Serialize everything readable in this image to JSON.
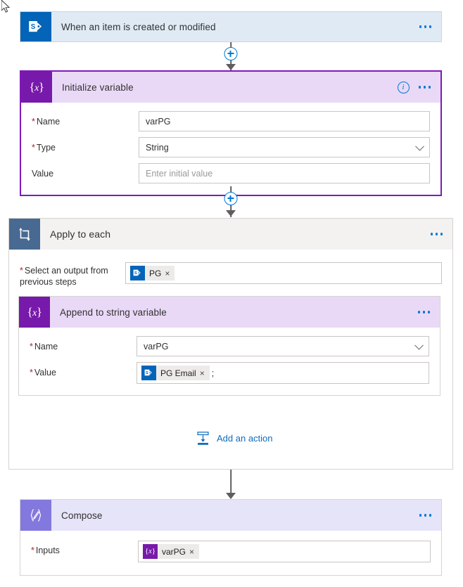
{
  "colors": {
    "accent_blue": "#0078d4",
    "link_blue": "#0f6cbd",
    "variable_purple": "#7719aa",
    "variable_header_bg": "#e9d9f7",
    "compose_purple": "#8378de",
    "compose_header_bg": "#e6e4f8",
    "loop_icon_bg": "#486991",
    "loop_header_bg": "#f3f2f1",
    "trigger_header_bg": "#dfeaf4",
    "sharepoint_blue": "#0364b8",
    "required_red": "#a4262c",
    "border_grey": "#c8c6c4"
  },
  "trigger": {
    "title": "When an item is created or modified",
    "icon": "sharepoint-icon",
    "overflow_label": "More commands"
  },
  "initialize_variable": {
    "title": "Initialize variable",
    "icon": "variable-braces-icon",
    "info_label": "i",
    "overflow_label": "More commands",
    "fields": [
      {
        "label": "Name",
        "required": true,
        "value": "varPG",
        "placeholder": "",
        "type": "text"
      },
      {
        "label": "Type",
        "required": true,
        "value": "String",
        "placeholder": "",
        "type": "dropdown"
      },
      {
        "label": "Value",
        "required": false,
        "value": "",
        "placeholder": "Enter initial value",
        "type": "text"
      }
    ]
  },
  "apply_to_each": {
    "title": "Apply to each",
    "icon": "loop-icon",
    "overflow_label": "More commands",
    "output_field": {
      "label": "Select an output from previous steps",
      "required": true,
      "token": {
        "icon": "sharepoint-icon",
        "label": "PG",
        "remove": "×"
      }
    },
    "add_action": {
      "label": "Add an action",
      "icon": "add-action-icon"
    }
  },
  "append_to_string": {
    "title": "Append to string variable",
    "icon": "variable-braces-icon",
    "overflow_label": "More commands",
    "name_field": {
      "label": "Name",
      "required": true,
      "value": "varPG",
      "type": "dropdown"
    },
    "value_field": {
      "label": "Value",
      "required": true,
      "token": {
        "icon": "sharepoint-icon",
        "label": "PG Email",
        "remove": "×"
      },
      "trailing_text": ";"
    }
  },
  "compose": {
    "title": "Compose",
    "icon": "compose-pen-icon",
    "overflow_label": "More commands",
    "inputs_field": {
      "label": "Inputs",
      "required": true,
      "token": {
        "icon": "variable-braces-icon",
        "label": "varPG",
        "remove": "×"
      }
    }
  },
  "connectors": [
    {
      "name": "trigger-to-initialize",
      "has_plus": true,
      "plus_label": "Insert a new step"
    },
    {
      "name": "initialize-to-loop",
      "has_plus": true,
      "plus_label": "Insert a new step"
    },
    {
      "name": "loop-to-compose",
      "has_plus": false,
      "plus_label": ""
    }
  ]
}
